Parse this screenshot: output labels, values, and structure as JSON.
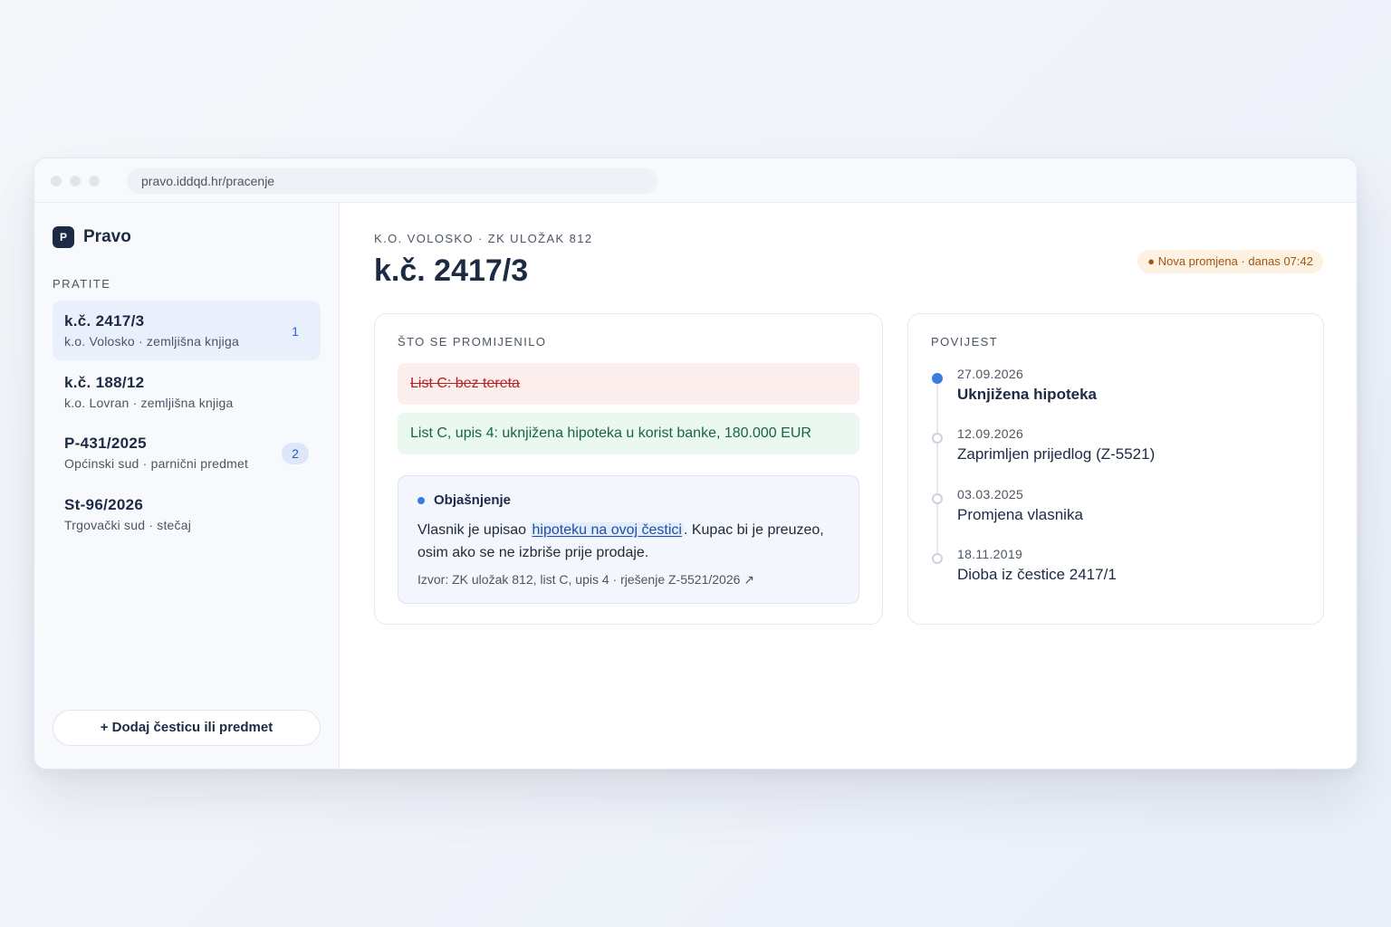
{
  "browser": {
    "url": "pravo.iddqd.hr/pracenje"
  },
  "sidebar": {
    "logo_letter": "P",
    "app_name": "Pravo",
    "section_label": "PRATITE",
    "items": [
      {
        "title": "k.č. 2417/3",
        "subtitle": "k.o. Volosko · zemljišna knjiga",
        "badge": "1",
        "active": true
      },
      {
        "title": "k.č. 188/12",
        "subtitle": "k.o. Lovran · zemljišna knjiga",
        "badge": "",
        "active": false
      },
      {
        "title": "P-431/2025",
        "subtitle": "Općinski sud · parnični predmet",
        "badge": "2",
        "active": false
      },
      {
        "title": "St-96/2026",
        "subtitle": "Trgovački sud · stečaj",
        "badge": "",
        "active": false
      }
    ],
    "add_button": "+ Dodaj česticu ili predmet"
  },
  "main": {
    "breadcrumb": "K.O. VOLOSKO · ZK ULOŽAK 812",
    "title": "k.č. 2417/3",
    "change_badge": "● Nova promjena · danas 07:42",
    "changes": {
      "label": "ŠTO SE PROMIJENILO",
      "removed": "List C: bez tereta",
      "added": "List C, upis 4: uknjižena hipoteka u korist banke, 180.000 EUR",
      "explanation": {
        "title": "Objašnjenje",
        "text_before": "Vlasnik je upisao ",
        "link": "hipoteku na ovoj čestici",
        "text_after": ". Kupac bi je preuzeo, osim ako se ne izbriše prije prodaje.",
        "source": "Izvor: ZK uložak 812, list C, upis 4 · rješenje Z-5521/2026 ↗"
      }
    },
    "history": {
      "label": "POVIJEST",
      "events": [
        {
          "date": "27.09.2026",
          "event": "Uknjižena hipoteka",
          "current": true
        },
        {
          "date": "12.09.2026",
          "event": "Zaprimljen prijedlog (Z-5521)",
          "current": false
        },
        {
          "date": "03.03.2025",
          "event": "Promjena vlasnika",
          "current": false
        },
        {
          "date": "18.11.2019",
          "event": "Dioba iz čestice 2417/1",
          "current": false
        }
      ]
    }
  },
  "colors": {
    "brand": "#1d2a44",
    "accent": "#3b7ddd",
    "removed_bg": "#fdeeee",
    "added_bg": "#eaf8f0",
    "change_badge": "#a25412"
  }
}
